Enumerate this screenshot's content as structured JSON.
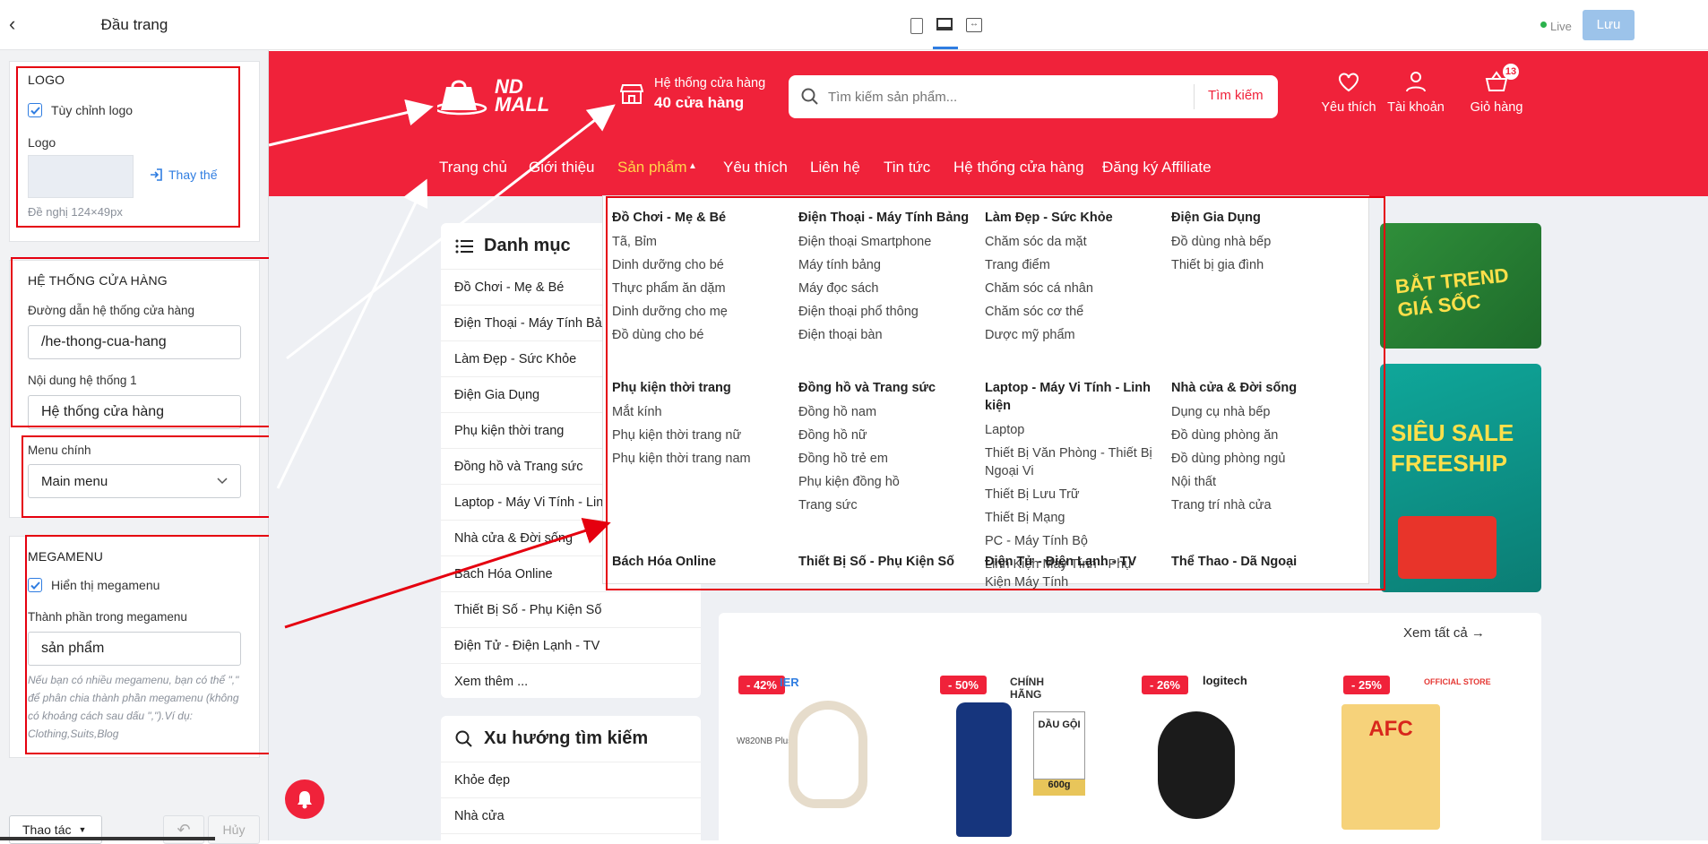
{
  "sidebar": {
    "title": "Đầu trang",
    "logo": {
      "section_title": "LOGO",
      "customize_label": "Tùy chỉnh logo",
      "logo_label": "Logo",
      "replace_label": "Thay thế",
      "hint": "Đề nghị 124×49px"
    },
    "store": {
      "section_title": "HỆ THỐNG CỬA HÀNG",
      "path_label": "Đường dẫn hệ thống cửa hàng",
      "path_value": "/he-thong-cua-hang",
      "content_label": "Nội dung hệ thống 1",
      "content_value": "Hệ thống cửa hàng"
    },
    "menu": {
      "label": "Menu chính",
      "value": "Main menu"
    },
    "megamenu": {
      "section_title": "MEGAMENU",
      "show_label": "Hiển thị megamenu",
      "component_label": "Thành phần trong megamenu",
      "component_value": "sản phẩm",
      "note": "Nếu bạn có nhiều megamenu, bạn có thể \",\" để phân chia thành phần megamenu (không có khoảng cách sau dấu \",\").Ví dụ: Clothing,Suits,Blog"
    },
    "actions_label": "Thao tác",
    "undo_label": "Hủy"
  },
  "topbar": {
    "live_label": "Live",
    "save_label": "Lưu",
    "colors": {
      "live_dot": "#2bb24c",
      "save_bg": "#9cc3ea"
    }
  },
  "site": {
    "brand_color": "#f0223a",
    "logo_text": "ND MALL",
    "store": {
      "line1": "Hệ thống cửa hàng",
      "line2": "40 cửa hàng"
    },
    "search": {
      "placeholder": "Tìm kiếm sản phẩm...",
      "button": "Tìm kiếm"
    },
    "actions": {
      "wishlist": "Yêu thích",
      "account": "Tài khoản",
      "cart": "Giỏ hàng",
      "cart_count": "13"
    },
    "nav": [
      "Trang chủ",
      "Giới thiệu",
      "Sản phẩm",
      "Yêu thích",
      "Liên hệ",
      "Tin tức",
      "Hệ thống cửa hàng",
      "Đăng ký Affiliate"
    ],
    "categories": {
      "title": "Danh mục",
      "items": [
        "Đồ Chơi - Mẹ & Bé",
        "Điện Thoại - Máy Tính Bảng",
        "Làm Đẹp - Sức Khỏe",
        "Điện Gia Dụng",
        "Phụ kiện thời trang",
        "Đồng hồ và Trang sức",
        "Laptop - Máy Vi Tính - Linh kiện",
        "Nhà cửa & Đời sống",
        "Bách Hóa Online",
        "Thiết Bị Số - Phụ Kiện Số",
        "Điện Tử - Điện Lạnh - TV",
        "Xem thêm ..."
      ]
    },
    "trends": {
      "title": "Xu hướng tìm kiếm",
      "items": [
        "Khỏe đẹp",
        "Nhà cửa"
      ]
    },
    "mega": [
      {
        "title": "Đồ Chơi - Mẹ & Bé",
        "links": [
          "Tã, Bỉm",
          "Dinh dưỡng cho bé",
          "Thực phẩm ăn dặm",
          "Dinh dưỡng cho mẹ",
          "Đồ dùng cho bé"
        ]
      },
      {
        "title": "Điện Thoại - Máy Tính Bảng",
        "links": [
          "Điện thoại Smartphone",
          "Máy tính bảng",
          "Máy đọc sách",
          "Điện thoại phổ thông",
          "Điện thoại bàn"
        ]
      },
      {
        "title": "Làm Đẹp - Sức Khỏe",
        "links": [
          "Chăm sóc da mặt",
          "Trang điểm",
          "Chăm sóc cá nhân",
          "Chăm sóc cơ thể",
          "Dược mỹ phẩm"
        ]
      },
      {
        "title": "Điện Gia Dụng",
        "links": [
          "Đồ dùng nhà bếp",
          "Thiết bị gia đình"
        ]
      },
      {
        "title": "Phụ kiện thời trang",
        "links": [
          "Mắt kính",
          "Phụ kiện thời trang nữ",
          "Phụ kiện thời trang nam"
        ]
      },
      {
        "title": "Đồng hồ và Trang sức",
        "links": [
          "Đồng hồ nam",
          "Đồng hồ nữ",
          "Đồng hồ trẻ em",
          "Phụ kiện đồng hồ",
          "Trang sức"
        ]
      },
      {
        "title": "Laptop - Máy Vi Tính - Linh kiện",
        "links": [
          "Laptop",
          "Thiết Bị Văn Phòng - Thiết Bị Ngoại Vi",
          "Thiết Bị Lưu Trữ",
          "Thiết Bị Mạng",
          "PC - Máy Tính Bộ",
          "Linh Kiện Máy Tính - Phụ Kiện Máy Tính"
        ]
      },
      {
        "title": "Nhà cửa & Đời sống",
        "links": [
          "Dụng cụ nhà bếp",
          "Đồ dùng phòng ăn",
          "Đồ dùng phòng ngủ",
          "Nội thất",
          "Trang trí nhà cửa"
        ]
      },
      {
        "title": "Bách Hóa Online",
        "links": []
      },
      {
        "title": "Thiết Bị Số - Phụ Kiện Số",
        "links": []
      },
      {
        "title": "Điện Tử - Điện Lạnh - TV",
        "links": []
      },
      {
        "title": "Thể Thao - Dã Ngoại",
        "links": []
      }
    ],
    "see_all": "Xem tất cả",
    "products": [
      {
        "discount": "- 42%",
        "tag": "IER",
        "model": "W820NB Plus"
      },
      {
        "discount": "- 50%",
        "tag": "CHÍNH HÃNG",
        "label": "DẦU GỘI",
        "label2": "600g"
      },
      {
        "discount": "- 26%",
        "tag": "logitech"
      },
      {
        "discount": "- 25%",
        "tag": "OFFICIAL STORE",
        "label": "AFC"
      }
    ],
    "banners": [
      "BẮT TREND GIÁ SỐC",
      "SIÊU SALE FREESHIP"
    ]
  }
}
